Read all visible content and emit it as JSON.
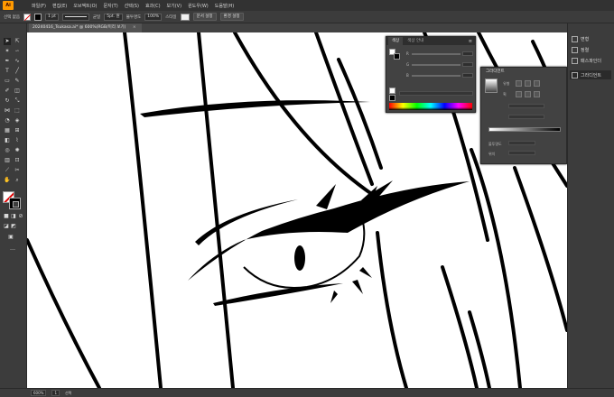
{
  "app": {
    "logo": "Ai"
  },
  "menu": [
    "파일(F)",
    "편집(E)",
    "오브젝트(O)",
    "문자(T)",
    "선택(S)",
    "효과(C)",
    "보기(V)",
    "윈도우(W)",
    "도움말(H)"
  ],
  "control_bar": {
    "selection_label": "선택 없음",
    "stroke_weight": "1 pt",
    "stroke_style": "균일",
    "brush": "5pt. 원",
    "opacity_label": "불투명도",
    "opacity_value": "100%",
    "style_label": "스타일",
    "doc_setup_button": "문서 설정",
    "preferences_button": "환경 설정"
  },
  "document_tab": {
    "title": "20240416_Tsukasa.ai* @ 600%(RGB/미리 보기)",
    "close": "×"
  },
  "color_panel": {
    "tabs": [
      "색상",
      "색상 안내"
    ],
    "menu": "≡"
  },
  "gradient_panel": {
    "title": "그라디언트",
    "type_label": "유형",
    "stroke_label": "획",
    "opacity_label": "불투명도",
    "location_label": "위치"
  },
  "right_dock": {
    "items": [
      {
        "label": "변형",
        "icon": "transform-icon"
      },
      {
        "label": "정렬",
        "icon": "align-icon"
      },
      {
        "label": "패스파인더",
        "icon": "pathfinder-icon"
      },
      {
        "label": "그라디언트",
        "icon": "gradient-icon"
      }
    ]
  },
  "status_bar": {
    "zoom": "600%",
    "artboard": "1",
    "mode": "선택"
  },
  "colors": {
    "panel_bg": "#424242",
    "toolbar_bg": "#3c3c3c",
    "menubar_bg": "#323232",
    "canvas": "#ffffff",
    "none_red": "#e10000"
  }
}
